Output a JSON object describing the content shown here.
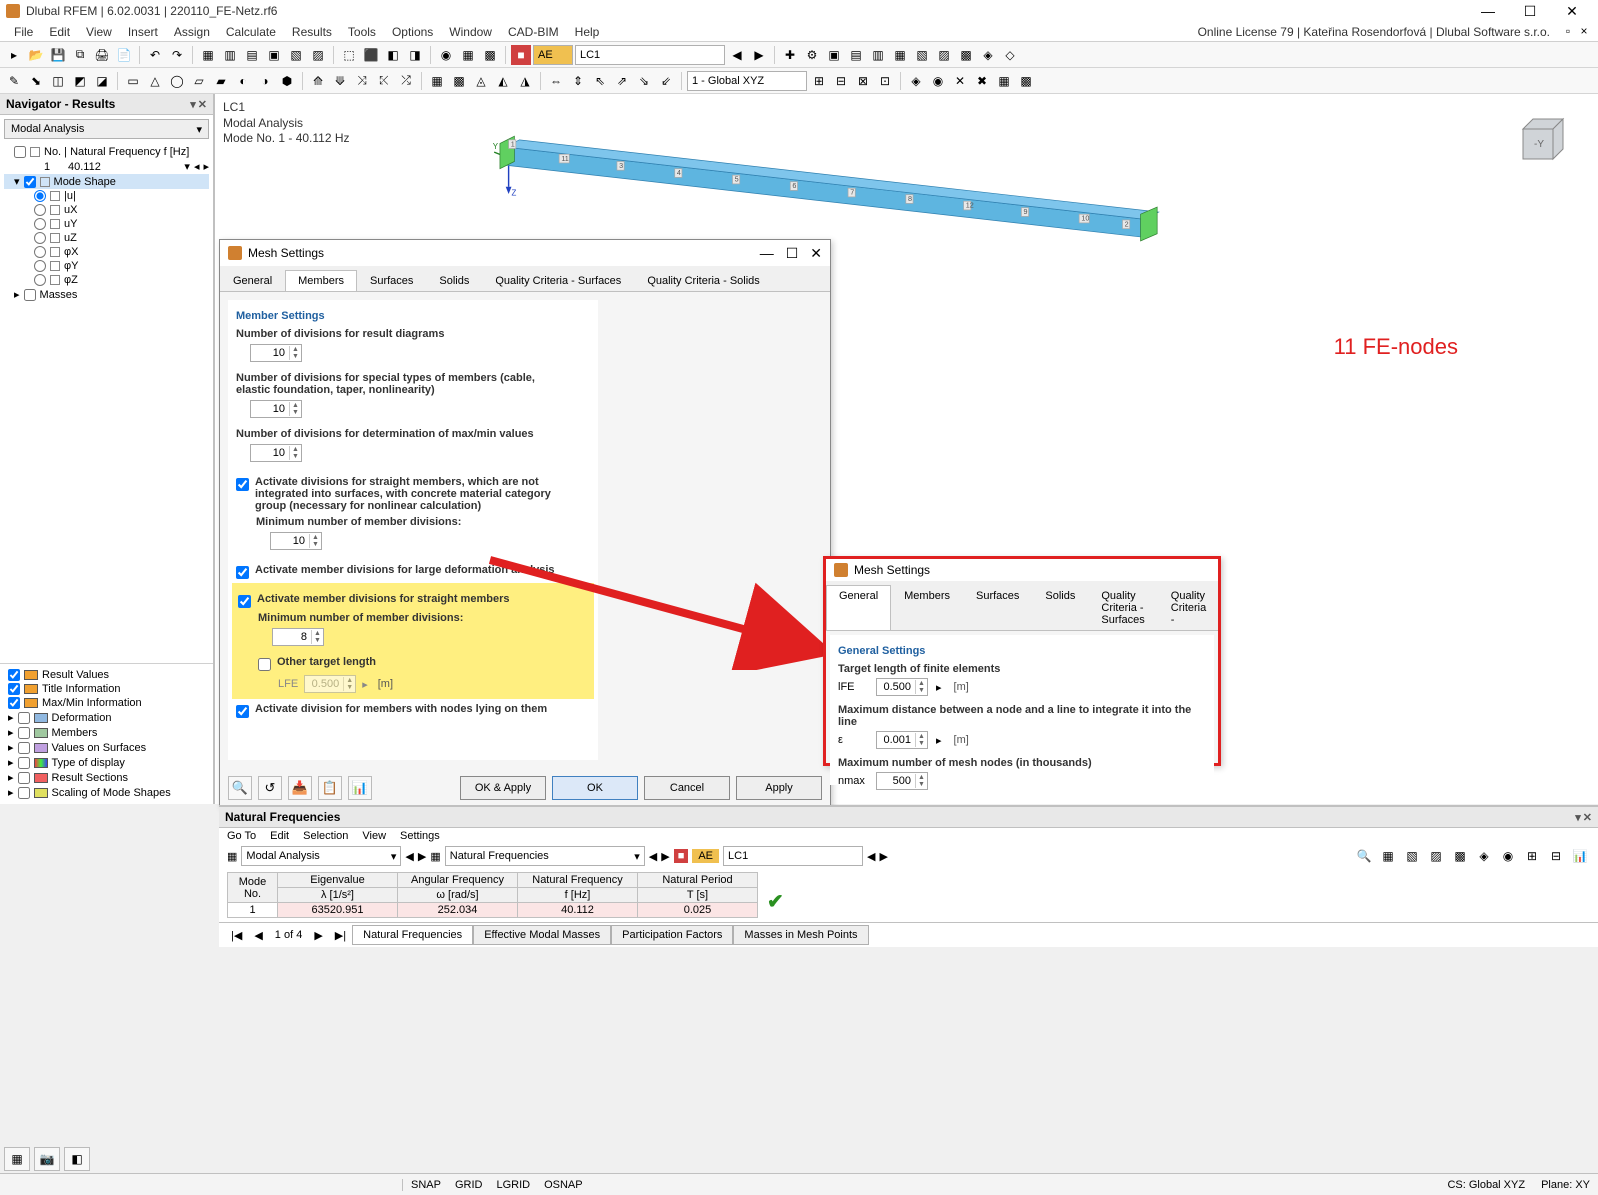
{
  "app": {
    "title": "Dlubal RFEM | 6.02.0031 | 220110_FE-Netz.rf6",
    "license": "Online License 79 | Kateřina Rosendorfová | Dlubal Software s.r.o."
  },
  "menu": {
    "items": [
      "File",
      "Edit",
      "View",
      "Insert",
      "Assign",
      "Calculate",
      "Results",
      "Tools",
      "Options",
      "Window",
      "CAD-BIM",
      "Help"
    ]
  },
  "toolbar_combo": {
    "cs": "1 - Global XYZ",
    "load": "LC1",
    "ae": "AE"
  },
  "nav": {
    "title": "Navigator - Results",
    "combo": "Modal Analysis",
    "row_freq": "No. | Natural Frequency f [Hz]",
    "freq_no": "1",
    "freq_val": "40.112",
    "modeshape": "Mode Shape",
    "items": [
      "|u|",
      "uX",
      "uY",
      "uZ",
      "φX",
      "φY",
      "φZ"
    ],
    "masses": "Masses",
    "bottom": [
      "Result Values",
      "Title Information",
      "Max/Min Information",
      "Deformation",
      "Members",
      "Values on Surfaces",
      "Type of display",
      "Result Sections",
      "Scaling of Mode Shapes"
    ]
  },
  "view": {
    "lc": "LC1",
    "analysis": "Modal Analysis",
    "mode": "Mode No. 1 - 40.112 Hz",
    "annot": "11 FE-nodes"
  },
  "dialog": {
    "title": "Mesh Settings",
    "tabs": [
      "General",
      "Members",
      "Surfaces",
      "Solids",
      "Quality Criteria - Surfaces",
      "Quality Criteria - Solids"
    ],
    "sect": "Member Settings",
    "lbl_div_result": "Number of divisions for result diagrams",
    "val_div_result": "10",
    "lbl_div_special": "Number of divisions for special types of members (cable, elastic foundation, taper, nonlinearity)",
    "val_div_special": "10",
    "lbl_div_maxmin": "Number of divisions for determination of max/min values",
    "val_div_maxmin": "10",
    "chk_straight_surf": "Activate divisions for straight members, which are not integrated into surfaces, with concrete material category group (necessary for nonlinear calculation)",
    "lbl_min_div": "Minimum number of member divisions:",
    "val_min_div": "10",
    "chk_large_def": "Activate member divisions for large deformation analysis",
    "chk_straight": "Activate member divisions for straight members",
    "lbl_min_div2": "Minimum number of member divisions:",
    "val_min_div2": "8",
    "chk_other_len": "Other target length",
    "lbl_lfe": "LFE",
    "val_lfe": "0.500",
    "unit_m": "[m]",
    "chk_nodes": "Activate division for members with nodes lying on them",
    "btn_ok_apply": "OK & Apply",
    "btn_ok": "OK",
    "btn_cancel": "Cancel",
    "btn_apply": "Apply"
  },
  "subdialog": {
    "title": "Mesh Settings",
    "tabs": [
      "General",
      "Members",
      "Surfaces",
      "Solids",
      "Quality Criteria - Surfaces",
      "Quality Criteria -"
    ],
    "sect": "General Settings",
    "lbl_target": "Target length of finite elements",
    "lbl_lfe": "lFE",
    "val_lfe": "0.500",
    "unit_m": "[m]",
    "lbl_maxdist": "Maximum distance between a node and a line to integrate it into the line",
    "lbl_eps": "ε",
    "val_eps": "0.001",
    "lbl_maxnodes": "Maximum number of mesh nodes (in thousands)",
    "lbl_nmax": "nmax",
    "val_nmax": "500"
  },
  "bottom": {
    "title": "Natural Frequencies",
    "menu": [
      "Go To",
      "Edit",
      "Selection",
      "View",
      "Settings"
    ],
    "combo1": "Modal Analysis",
    "combo2": "Natural Frequencies",
    "load": "LC1",
    "ae": "AE",
    "tbl": {
      "h1": "Mode\nNo.",
      "h2a": "Eigenvalue",
      "h2b": "λ [1/s²]",
      "h3a": "Angular Frequency",
      "h3b": "ω [rad/s]",
      "h4a": "Natural Frequency",
      "h4b": "f [Hz]",
      "h5a": "Natural Period",
      "h5b": "T [s]",
      "r_no": "1",
      "r_ev": "63520.951",
      "r_af": "252.034",
      "r_nf": "40.112",
      "r_np": "0.025"
    },
    "pager": "1 of 4",
    "tabs": [
      "Natural Frequencies",
      "Effective Modal Masses",
      "Participation Factors",
      "Masses in Mesh Points"
    ]
  },
  "status": {
    "snap": "SNAP",
    "grid": "GRID",
    "lgrid": "LGRID",
    "osnap": "OSNAP",
    "cs": "CS: Global XYZ",
    "plane": "Plane: XY"
  }
}
